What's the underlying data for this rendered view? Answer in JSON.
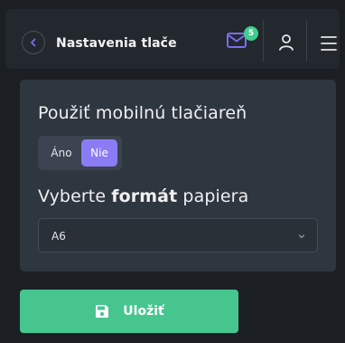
{
  "header": {
    "title": "Nastavenia tlače",
    "notification_count": "5",
    "icons": {
      "back": "chevron-left-icon",
      "mail": "mail-icon",
      "user": "user-icon",
      "menu": "menu-icon"
    }
  },
  "settings": {
    "mobile_printer_label": "Použiť mobilnú tlačiareň",
    "toggle": {
      "options": [
        "Áno",
        "Nie"
      ],
      "selected": "Nie"
    },
    "format_label": {
      "prefix": "Vyberte ",
      "bold": "formát",
      "suffix": " papiera"
    },
    "format_select": {
      "value": "A6",
      "icon": "chevron-down-icon"
    }
  },
  "actions": {
    "save_label": "Uložiť",
    "save_icon": "floppy-disk-icon"
  },
  "colors": {
    "background": "#1b1f24",
    "header": "#23282e",
    "card": "#2e3640",
    "toggle_active": "#8b7cf6",
    "save_button": "#46c58f",
    "badge": "#3ecf8e",
    "accent_icon": "#7b6cf0"
  }
}
